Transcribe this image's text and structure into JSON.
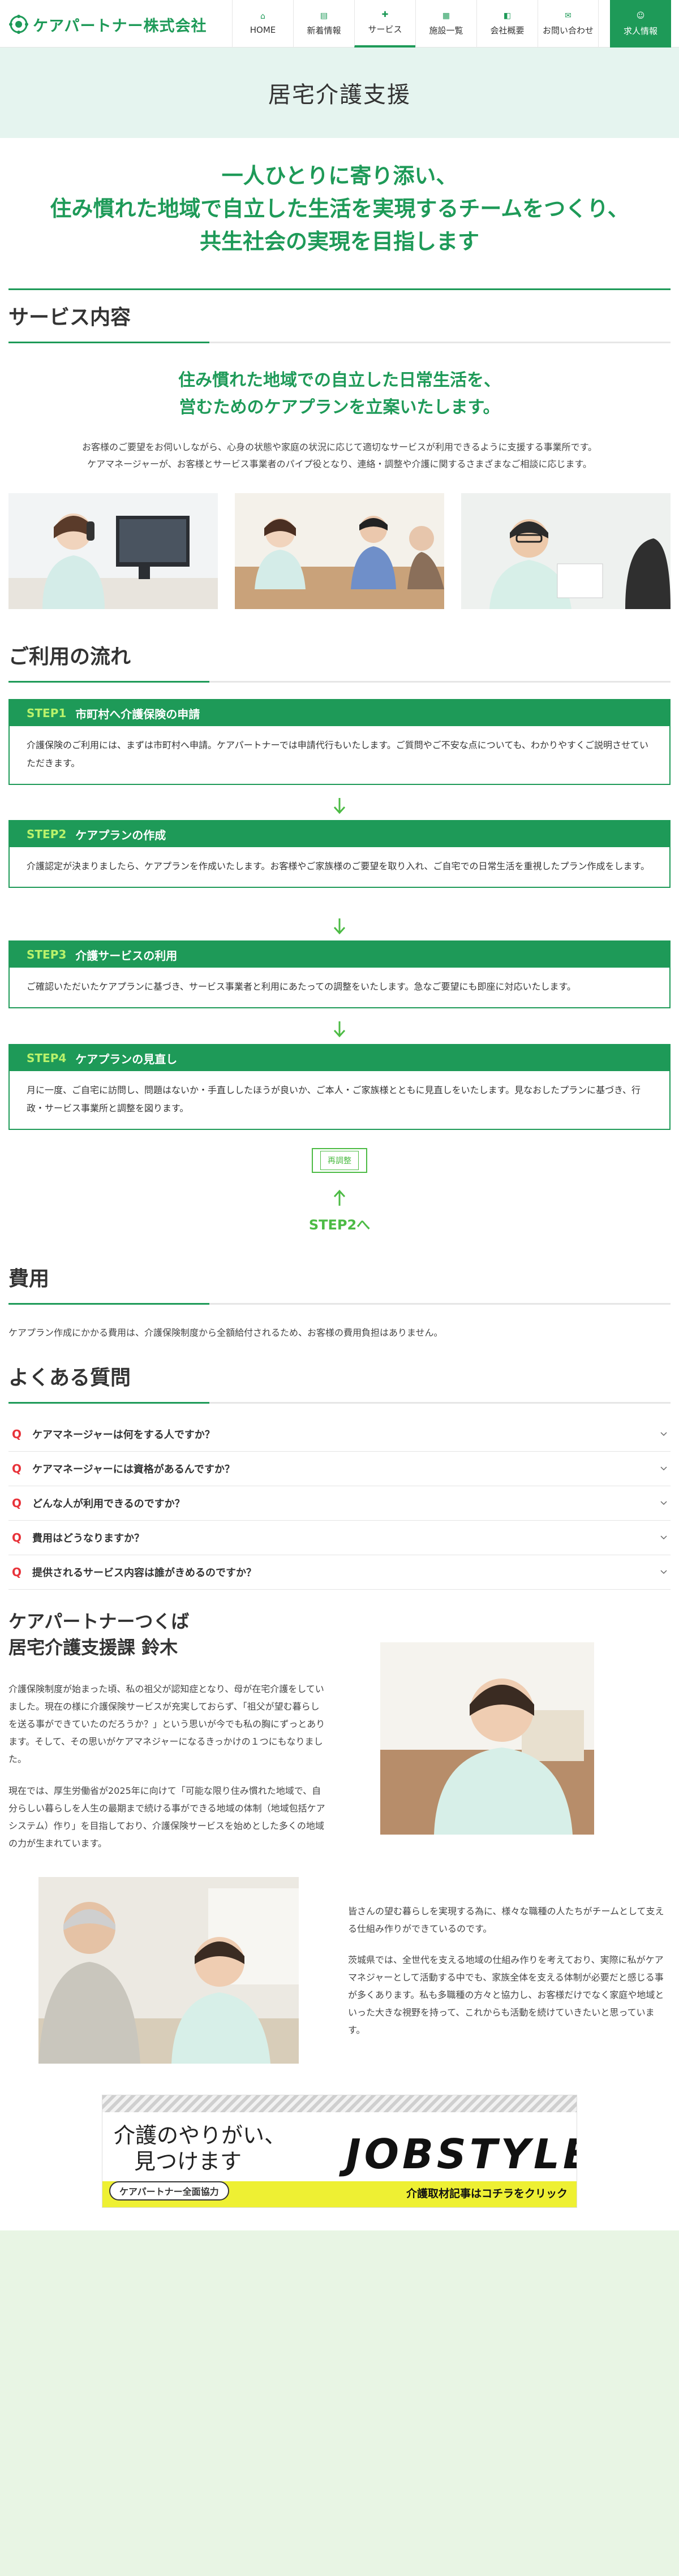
{
  "header": {
    "logo_text": "ケアパートナー株式会社",
    "nav": [
      {
        "label": "HOME",
        "icon": "home-icon"
      },
      {
        "label": "新着情報",
        "icon": "news-icon"
      },
      {
        "label": "サービス",
        "icon": "service-icon"
      },
      {
        "label": "施設一覧",
        "icon": "facility-icon"
      },
      {
        "label": "会社概要",
        "icon": "company-icon"
      },
      {
        "label": "お問い合わせ",
        "icon": "mail-icon"
      }
    ],
    "recruit": "求人情報",
    "active_index": 2
  },
  "page_title": "居宅介護支援",
  "catch": [
    "一人ひとりに寄り添い、",
    "住み慣れた地域で自立した生活を実現するチームをつくり、",
    "共生社会の実現を目指します"
  ],
  "service": {
    "title": "サービス内容",
    "lead": [
      "住み慣れた地域での自立した日常生活を、",
      "営むためのケアプランを立案いたします。"
    ],
    "desc": [
      "お客様のご要望をお伺いしながら、心身の状態や家庭の状況に応じて適切なサービスが利用できるように支援する事業所です。",
      "ケアマネージャーが、お客様とサービス事業者のパイプ役となり、連絡・調整や介護に関するさまざまなご相談に応じます。"
    ]
  },
  "flow": {
    "title": "ご利用の流れ",
    "steps": [
      {
        "no": "STEP1",
        "title": "市町村へ介護保険の申請",
        "body": "介護保険のご利用には、まずは市町村へ申請。ケアパートナーでは申請代行もいたします。ご質問やご不安な点についても、わかりやすくご説明させていただきます。"
      },
      {
        "no": "STEP2",
        "title": "ケアプランの作成",
        "body": "介護認定が決まりましたら、ケアプランを作成いたします。お客様やご家族様のご要望を取り入れ、ご自宅での日常生活を重視したプラン作成をします。"
      },
      {
        "no": "STEP3",
        "title": "介護サービスの利用",
        "body": "ご確認いただいたケアプランに基づき、サービス事業者と利用にあたっての調整をいたします。急なご要望にも即座に対応いたします。"
      },
      {
        "no": "STEP4",
        "title": "ケアプランの見直し",
        "body": "月に一度、ご自宅に訪問し、問題はないか・手直ししたほうが良いか、ご本人・ご家族様とともに見直しをいたします。見なおしたプランに基づき、行政・サービス事業所と調整を図ります。"
      }
    ],
    "reset_label": "再調整",
    "back_label": "STEP2へ"
  },
  "cost": {
    "title": "費用",
    "text": "ケアプラン作成にかかる費用は、介護保険制度から全額給付されるため、お客様の費用負担はありません。"
  },
  "faq": {
    "title": "よくある質問",
    "q_mark": "Q",
    "items": [
      "ケアマネージャーは何をする人ですか？",
      "ケアマネージャーには資格があるんですか？",
      "どんな人が利用できるのですか？",
      "費用はどうなりますか？",
      "提供されるサービス内容は誰がきめるのですか？"
    ]
  },
  "interview": {
    "name": [
      "ケアパートナーつくば",
      "居宅介護支援課 鈴木"
    ],
    "p1": "介護保険制度が始まった頃、私の祖父が認知症となり、母が在宅介護をしていました。現在の様に介護保険サービスが充実しておらず、「祖父が望む暮らしを送る事ができていたのだろうか？」という思いが今でも私の胸にずっとあります。そして、その思いがケアマネジャーになるきっかけの１つにもなりました。",
    "p2": "現在では、厚生労働省が2025年に向けて「可能な限り住み慣れた地域で、自分らしい暮らしを人生の最期まで続ける事ができる地域の体制（地域包括ケアシステム）作り」を目指しており、介護保険サービスを始めとした多くの地域の力が生まれています。",
    "p3": "皆さんの望む暮らしを実現する為に、様々な職種の人たちがチームとして支える仕組み作りができているのです。",
    "p4": "茨城県では、全世代を支える地域の仕組み作りを考えており、実際に私がケアマネジャーとして活動する中でも、家族全体を支える体制が必要だと感じる事が多くあります。私も多職種の方々と協力し、お客様だけでなく家庭や地域といった大きな視野を持って、これからも活動を続けていきたいと思っています。"
  },
  "banner": {
    "hand_line1": "介護のやりがい、",
    "hand_line2": "見つけます",
    "brand": "JOBSTYLE",
    "badge": "ケアパートナー全面協力",
    "link": "介護取材記事はコチラをクリック"
  },
  "colors": {
    "accent": "#1e9a58",
    "step_no": "#b9f26b",
    "q_mark": "#e8333a",
    "footer_bg": "#e8f5e4",
    "title_bg": "#e5f4ef"
  }
}
